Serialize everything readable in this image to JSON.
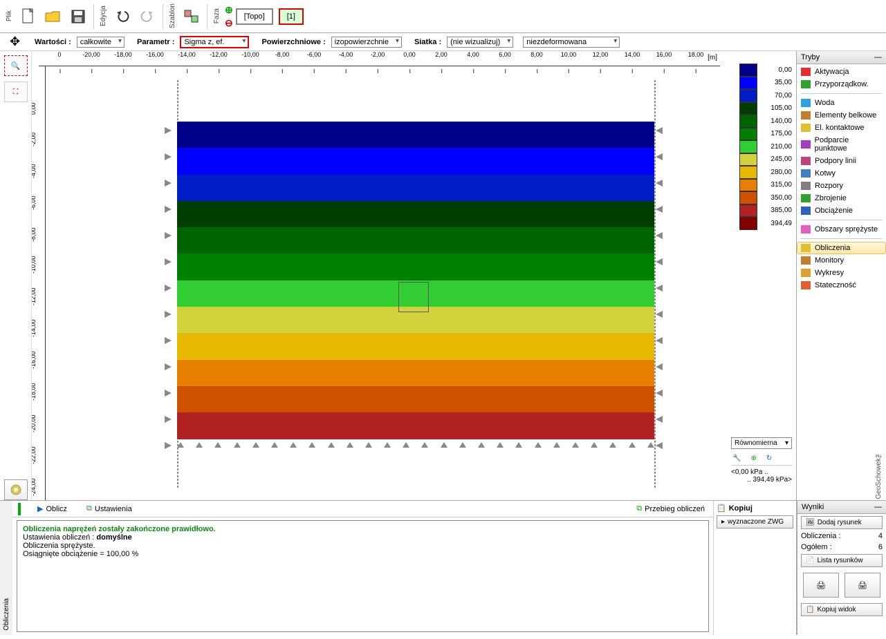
{
  "toolbar": {
    "file_label": "Plik",
    "edit_label": "Edycja",
    "template_label": "Szablon",
    "phase_label": "Faza",
    "topo_btn": "[Topo]",
    "phase1_btn": "[1]"
  },
  "params": {
    "values_label": "Wartości :",
    "values_select": "całkowite",
    "param_label": "Parametr :",
    "param_select": "Sigma z, ef.",
    "surface_label": "Powierzchniowe :",
    "surface_select": "izopowierzchnie",
    "mesh_label": "Siatka :",
    "mesh_select": "(nie wizualizuj)",
    "deform_select": "niezdeformowana"
  },
  "ruler": {
    "unit": "[m]",
    "x": [
      "0",
      "-20,00",
      "-18,00",
      "-16,00",
      "-14,00",
      "-12,00",
      "-10,00",
      "-8,00",
      "-6,00",
      "-4,00",
      "-2,00",
      "0,00",
      "2,00",
      "4,00",
      "6,00",
      "8,00",
      "10,00",
      "12,00",
      "14,00",
      "16,00",
      "18,00"
    ],
    "y": [
      "0,00",
      "-2,00",
      "-4,00",
      "-6,00",
      "-8,00",
      "-10,00",
      "-12,00",
      "-14,00",
      "-16,00",
      "-18,00",
      "-20,00",
      "-22,00",
      "-24,00"
    ]
  },
  "chart_data": {
    "type": "heatmap",
    "title": "Sigma z, ef.",
    "xlabel": "m",
    "ylabel": "m",
    "xlim": [
      -20,
      18
    ],
    "ylim": [
      -24,
      0
    ],
    "legend_values": [
      "0,00",
      "35,00",
      "70,00",
      "105,00",
      "140,00",
      "175,00",
      "210,00",
      "245,00",
      "280,00",
      "315,00",
      "350,00",
      "385,00",
      "394,49"
    ],
    "legend_colors": [
      "#00008b",
      "#0000ff",
      "#001dc8",
      "#003e00",
      "#006400",
      "#008000",
      "#32cd32",
      "#d2d23c",
      "#e6b800",
      "#e67e00",
      "#cc5200",
      "#b22222",
      "#800000"
    ],
    "unit": "kPa",
    "range_min": "<0,00 kPa ..",
    "range_max": ".. 394,49 kPa>",
    "scale_type": "Równomierna"
  },
  "modes": {
    "title": "Tryby",
    "items": [
      "Aktywacja",
      "Przyporządkow.",
      "Woda",
      "Elementy belkowe",
      "El. kontaktowe",
      "Podparcie punktowe",
      "Podpory linii",
      "Kotwy",
      "Rozpory",
      "Zbrojenie",
      "Obciążenie",
      "Obszary sprężyste",
      "Obliczenia",
      "Monitory",
      "Wykresy",
      "Stateczność"
    ],
    "selected_index": 12
  },
  "bottom": {
    "side_label": "Obliczenia",
    "oblicz": "Oblicz",
    "ustawienia": "Ustawienia",
    "przebieg": "Przebieg obliczeń",
    "log_ok": "Obliczenia naprężeń zostały zakończone prawidłowo.",
    "log_settings": "Ustawienia obliczeń : ",
    "log_settings_val": "domyślne",
    "log_elastic": "Obliczenia sprężyste.",
    "log_load": "Osiągnięte obciążenie = 100,00 %"
  },
  "kopiuj": {
    "title": "Kopiuj",
    "btn1": "wyznaczone ZWG"
  },
  "wyniki": {
    "title": "Wyniki",
    "add_btn": "Dodaj rysunek",
    "row1_label": "Obliczenia :",
    "row1_val": "4",
    "row2_label": "Ogółem :",
    "row2_val": "6",
    "list_btn": "Lista rysunków",
    "copy_view": "Kopiuj widok"
  },
  "geo_label": "GeoSchowek™"
}
